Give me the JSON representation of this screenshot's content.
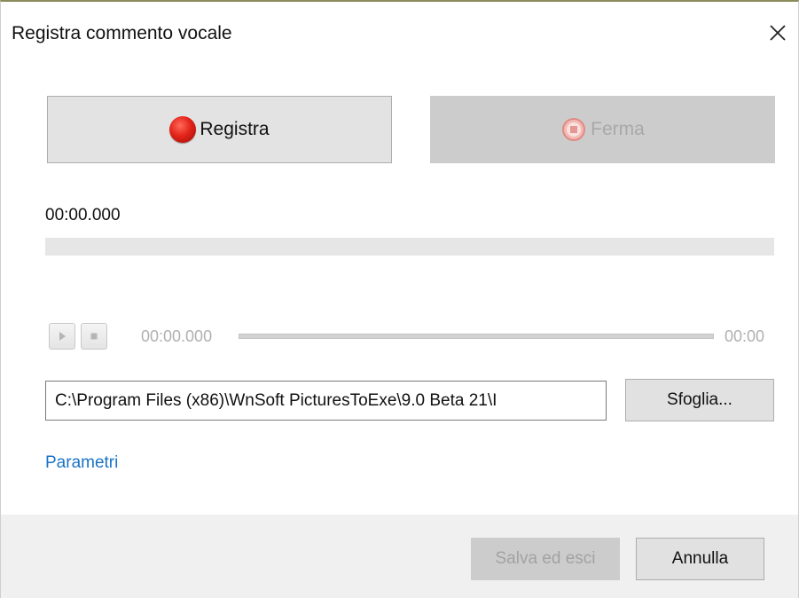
{
  "window": {
    "title": "Registra commento vocale",
    "close_icon": "close-icon"
  },
  "recorder": {
    "record_label": "Registra",
    "record_icon": "record-icon",
    "stop_label": "Ferma",
    "stop_icon": "stop-record-icon",
    "elapsed": "00:00.000",
    "level": 0
  },
  "player": {
    "play_icon": "play-icon",
    "stop_icon": "stop-icon",
    "current_time": "00:00.000",
    "total_time": "00:00",
    "position": 0
  },
  "file": {
    "path": "C:\\Program Files (x86)\\WnSoft PicturesToExe\\9.0 Beta 21\\I",
    "browse_label": "Sfoglia..."
  },
  "links": {
    "parameters": "Parametri"
  },
  "footer": {
    "save_label": "Salva ed esci",
    "cancel_label": "Annulla"
  },
  "colors": {
    "accent_link": "#1a73c7",
    "record_red": "#e3241a",
    "disabled_text": "#a8a8a8"
  }
}
